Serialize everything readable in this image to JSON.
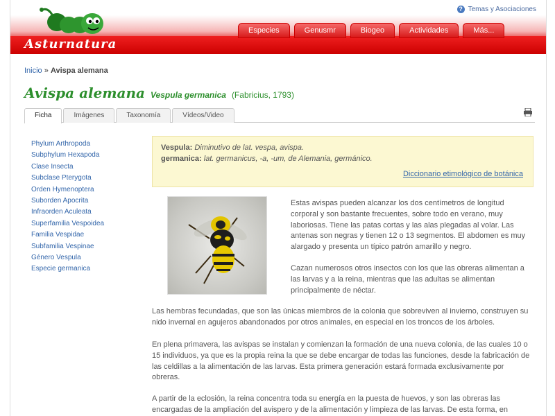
{
  "header": {
    "logo_text": "Asturnatura",
    "help_text": "Temas y Asociaciones",
    "nav": [
      "Especies",
      "Genusmr",
      "Biogeo",
      "Actividades",
      "Más..."
    ]
  },
  "breadcrumb": {
    "home": "Inicio",
    "separator": "»",
    "current": "Avispa alemana"
  },
  "title": {
    "common_name": "Avispa alemana",
    "scientific_name": "Vespula germanica",
    "author": "(Fabricius, 1793)"
  },
  "tabs": [
    "Ficha",
    "Imágenes",
    "Taxonomía",
    "Vídeos/Video"
  ],
  "sidebar": {
    "items": [
      "Phylum Arthropoda",
      "Subphylum Hexapoda",
      "Clase Insecta",
      "Subclase Pterygota",
      "Orden Hymenoptera",
      "Suborden Apocrita",
      "Infraorden Aculeata",
      "Superfamilia Vespoidea",
      "Familia Vespidae",
      "Subfamilia Vespinae",
      "Género Vespula",
      "Especie germanica"
    ]
  },
  "etymology": {
    "line1_term": "Vespula:",
    "line1_text": "Diminutivo de lat. vespa, avispa.",
    "line2_term": "germanica:",
    "line2_text": "lat. germanicus, -a, -um, de Alemania, germánico.",
    "more_link": "Diccionario etimológico de botánica"
  },
  "body": {
    "p1": "Estas avispas pueden alcanzar los dos centímetros de longitud corporal y son bastante frecuentes, sobre todo en verano, muy laboriosas. Tiene las patas cortas y las alas plegadas al volar. Las antenas son negras y tienen 12 o 13 segmentos. El abdomen es muy alargado y presenta un típico patrón amarillo y negro.",
    "p2": "Cazan numerosos otros insectos con los que las obreras alimentan a las larvas y a la reina, mientras que las adultas se alimentan principalmente de néctar.",
    "p3": "Las hembras fecundadas, que son las únicas miembros de la colonia que sobreviven al invierno, construyen su nido invernal en agujeros abandonados por otros animales, en especial en los troncos de los árboles.",
    "p4": "En plena primavera, las avispas se instalan y comienzan la formación de una nueva colonia, de las cuales 10 o 15 individuos, ya que es la propia reina la que se debe encargar de todas las funciones, desde la fabricación de las celdillas a la alimentación de las larvas. Esta primera generación estará formada exclusivamente por obreras.",
    "p5": "A partir de la eclosión, la reina concentra toda su energía en la puesta de huevos, y son las obreras las encargadas de la ampliación del avispero y de la alimentación y limpieza de las larvas. De esta forma, en"
  }
}
